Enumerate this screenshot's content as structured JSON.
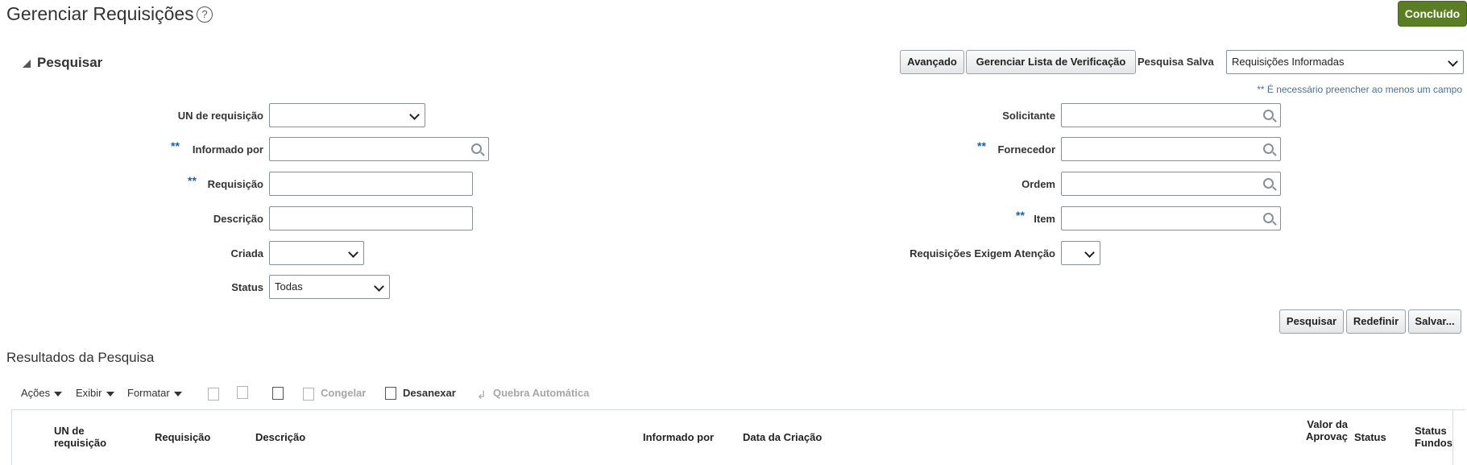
{
  "page": {
    "title": "Gerenciar Requisições",
    "help_icon": "?",
    "done_label": "Concluído"
  },
  "search": {
    "section_title": "Pesquisar",
    "advanced_label": "Avançado",
    "checklist_label": "Gerenciar Lista de Verificação",
    "saved_search_label": "Pesquisa Salva",
    "saved_search_value": "Requisições Informadas",
    "required_note": "** É necessário preencher ao menos um campo",
    "req_marker": "**",
    "fields": {
      "business_unit": {
        "label": "UN de requisição",
        "value": ""
      },
      "entered_by": {
        "label": "Informado por",
        "value": ""
      },
      "requisition": {
        "label": "Requisição",
        "value": ""
      },
      "description": {
        "label": "Descrição",
        "value": ""
      },
      "created": {
        "label": "Criada",
        "value": ""
      },
      "status": {
        "label": "Status",
        "value": "Todas"
      },
      "requester": {
        "label": "Solicitante",
        "value": ""
      },
      "supplier": {
        "label": "Fornecedor",
        "value": ""
      },
      "order": {
        "label": "Ordem",
        "value": ""
      },
      "item": {
        "label": "Item",
        "value": ""
      },
      "attention": {
        "label": "Requisições Exigem Atenção",
        "value": ""
      }
    },
    "buttons": {
      "search": "Pesquisar",
      "reset": "Redefinir",
      "save": "Salvar..."
    }
  },
  "results": {
    "title": "Resultados da Pesquisa",
    "toolbar": {
      "actions": "Ações",
      "view": "Exibir",
      "format": "Formatar",
      "freeze": "Congelar",
      "detach": "Desanexar",
      "wrap": "Quebra Automática"
    },
    "columns": {
      "business_unit": "UN de requisição",
      "requisition": "Requisição",
      "description": "Descrição",
      "entered_by": "Informado por",
      "creation_date": "Data da Criação",
      "approval_amount": "Valor da Aprovaç",
      "status": "Status",
      "funds_status": "Status Fundos"
    }
  },
  "colors": {
    "done_button": "#5b7e24",
    "required_marker": "#1f5fa8"
  }
}
